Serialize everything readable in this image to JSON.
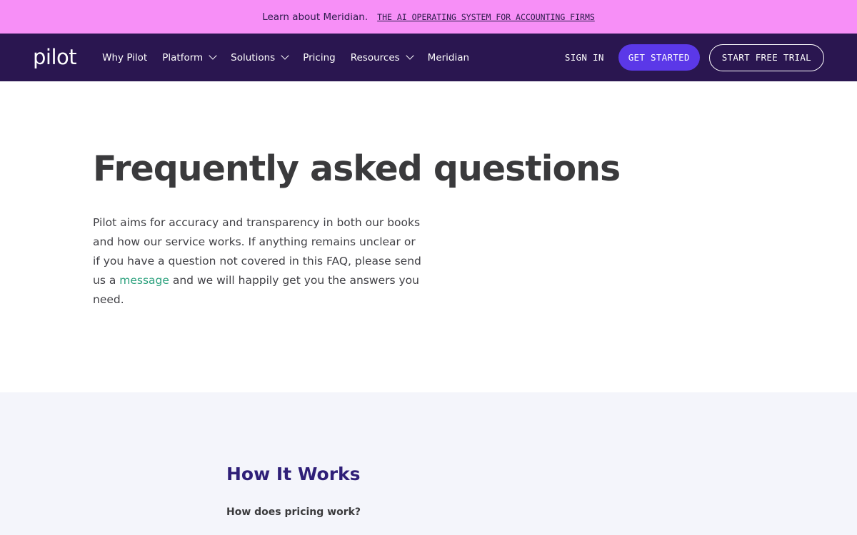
{
  "announcement": {
    "lead": "Learn about Meridian.",
    "link": "THE AI OPERATING SYSTEM FOR ACCOUNTING FIRMS"
  },
  "nav": {
    "logo": "pilot",
    "links": [
      {
        "label": "Why Pilot",
        "dropdown": false
      },
      {
        "label": "Platform",
        "dropdown": true
      },
      {
        "label": "Solutions",
        "dropdown": true
      },
      {
        "label": "Pricing",
        "dropdown": false
      },
      {
        "label": "Resources",
        "dropdown": true
      },
      {
        "label": "Meridian",
        "dropdown": false
      }
    ],
    "sign_in": "SIGN IN",
    "get_started": "GET STARTED",
    "free_trial": "START FREE TRIAL"
  },
  "hero": {
    "title": "Frequently asked questions",
    "body_before": "Pilot aims for accuracy and transparency in both our books and how our service works. If anything remains unclear or if you have a question not covered in this FAQ, please send us a ",
    "body_link": "message",
    "body_after": " and we will happily get you the answers you need."
  },
  "faq": {
    "section_title": "How It Works",
    "questions": [
      "How does pricing work?"
    ]
  },
  "colors": {
    "announcement_bg": "#f78ff7",
    "nav_bg": "#2a1650",
    "accent_button": "#5b38e8",
    "link_green": "#2aa07c",
    "section_title": "#2f1f78"
  }
}
